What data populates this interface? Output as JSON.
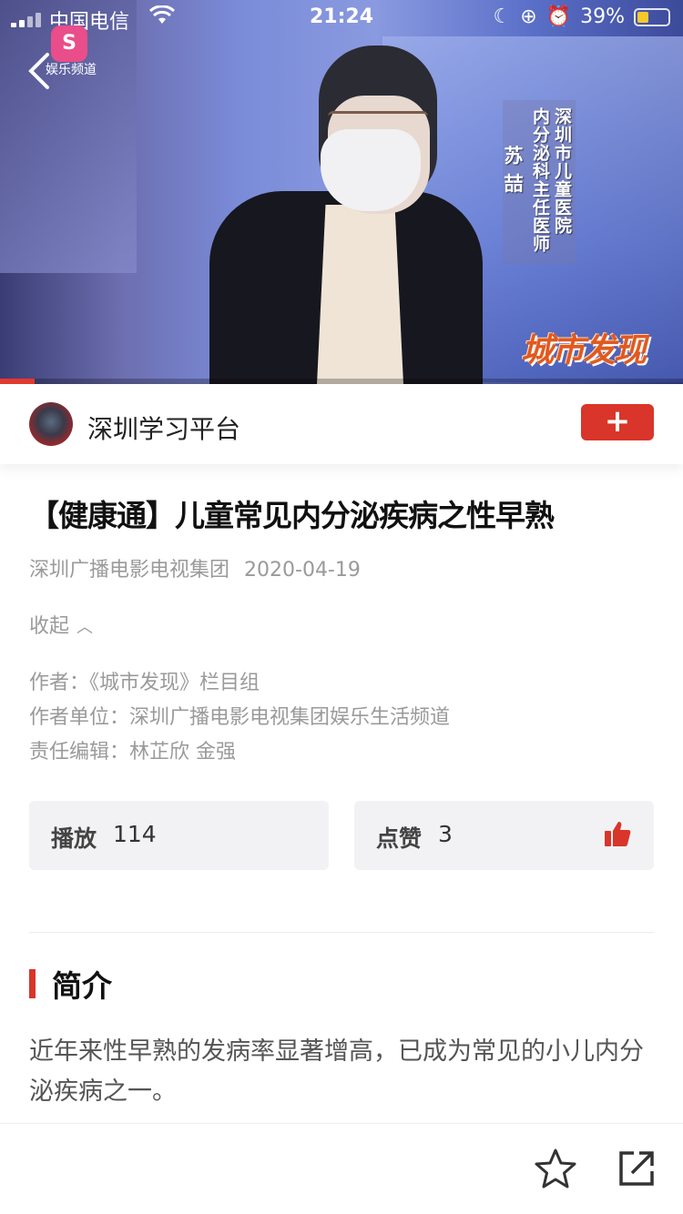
{
  "status_bar": {
    "carrier": "中国电信",
    "time": "21:24",
    "battery": "39%"
  },
  "video": {
    "channel_logo_text": "S",
    "channel_name": "娱乐频道",
    "caption_line1": "深圳市儿童医院",
    "caption_line2": "内分泌科主任医师",
    "caption_name": "苏 喆",
    "show_logo": "城市发现",
    "progress_fraction": 0.05
  },
  "publisher": {
    "name": "深圳学习平台",
    "follow_label": "+"
  },
  "article": {
    "title": "【健康通】儿童常见内分泌疾病之性早熟",
    "source": "深圳广播电影电视集团",
    "date": "2020-04-19",
    "collapse_label": "收起",
    "author": "作者：《城市发现》栏目组",
    "author_unit": "作者单位：深圳广播电影电视集团娱乐生活频道",
    "editors": "责任编辑：林芷欣 金强"
  },
  "stats": {
    "plays_label": "播放",
    "plays_value": "114",
    "likes_label": "点赞",
    "likes_value": "3"
  },
  "intro": {
    "heading": "简介",
    "text": "近年来性早熟的发病率显著增高，已成为常见的小儿内分泌疾病之一。"
  },
  "colors": {
    "accent": "#d9352a",
    "muted_text": "#9a9a9a"
  },
  "icons": [
    "back-icon",
    "thumbs-up-icon",
    "star-icon",
    "share-icon",
    "wifi-icon",
    "battery-icon"
  ]
}
